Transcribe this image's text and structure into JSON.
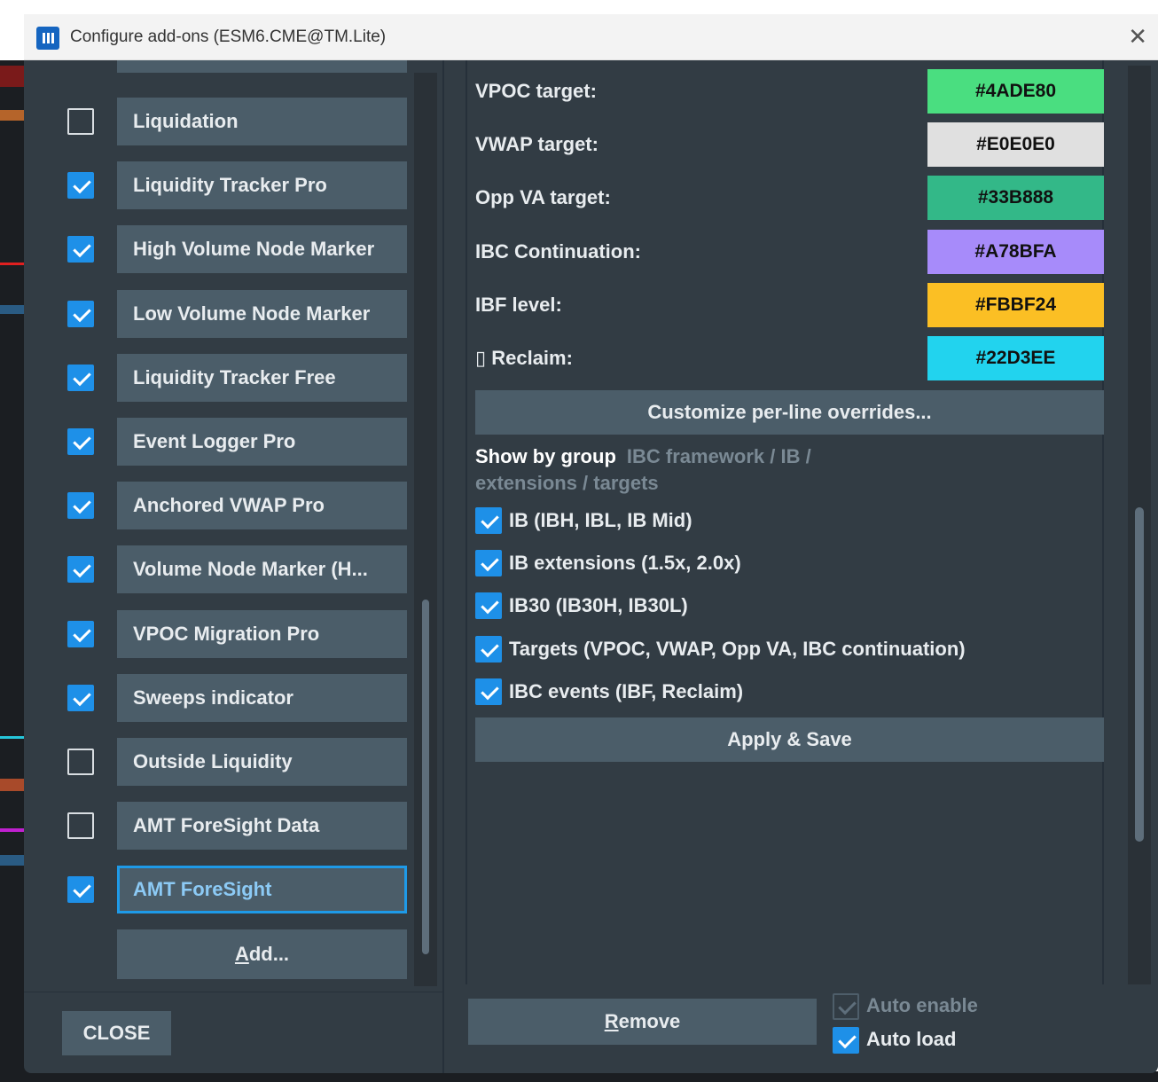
{
  "window": {
    "title": "Configure add-ons (ESM6.CME@TM.Lite)"
  },
  "addons": [
    {
      "label": "Liquidation",
      "checked": false
    },
    {
      "label": "Liquidity Tracker Pro",
      "checked": true
    },
    {
      "label": "High Volume Node Marker",
      "checked": true
    },
    {
      "label": "Low Volume Node Marker",
      "checked": true
    },
    {
      "label": "Liquidity Tracker Free",
      "checked": true
    },
    {
      "label": "Event Logger Pro",
      "checked": true
    },
    {
      "label": "Anchored VWAP Pro",
      "checked": true
    },
    {
      "label": "Volume Node Marker (H...",
      "checked": true
    },
    {
      "label": "VPOC Migration Pro",
      "checked": true
    },
    {
      "label": "Sweeps indicator",
      "checked": true
    },
    {
      "label": "Outside Liquidity",
      "checked": false
    },
    {
      "label": "AMT ForeSight Data",
      "checked": false
    },
    {
      "label": "AMT ForeSight",
      "checked": true,
      "selected": true
    }
  ],
  "left_actions": {
    "add_label_underlined": "A",
    "add_label_rest": "dd...",
    "close_label": "CLOSE"
  },
  "colors": [
    {
      "label": "VPOC target:",
      "value": "#4ADE80"
    },
    {
      "label": "VWAP target:",
      "value": "#E0E0E0"
    },
    {
      "label": "Opp VA target:",
      "value": "#33B888"
    },
    {
      "label": "IBC Continuation:",
      "value": "#A78BFA"
    },
    {
      "label": "IBF level:",
      "value": "#FBBF24"
    },
    {
      "label": "▯ Reclaim:",
      "value": "#22D3EE"
    }
  ],
  "customize_label": "Customize per-line overrides...",
  "show_by_group": {
    "title": "Show by group",
    "hint": "IBC framework / IB / extensions / targets"
  },
  "groups": [
    {
      "label": "IB (IBH, IBL, IB Mid)",
      "checked": true
    },
    {
      "label": "IB extensions (1.5x, 2.0x)",
      "checked": true
    },
    {
      "label": "IB30 (IB30H, IB30L)",
      "checked": true
    },
    {
      "label": "Targets (VPOC, VWAP, Opp VA, IBC continuation)",
      "checked": true
    },
    {
      "label": "IBC events (IBF, Reclaim)",
      "checked": true
    }
  ],
  "apply_label": "Apply & Save",
  "bottom": {
    "remove_underlined": "R",
    "remove_rest": "emove",
    "auto_enable_label": "Auto enable",
    "auto_enable_checked": true,
    "auto_enable_disabled": true,
    "auto_load_label": "Auto load",
    "auto_load_checked": true
  }
}
